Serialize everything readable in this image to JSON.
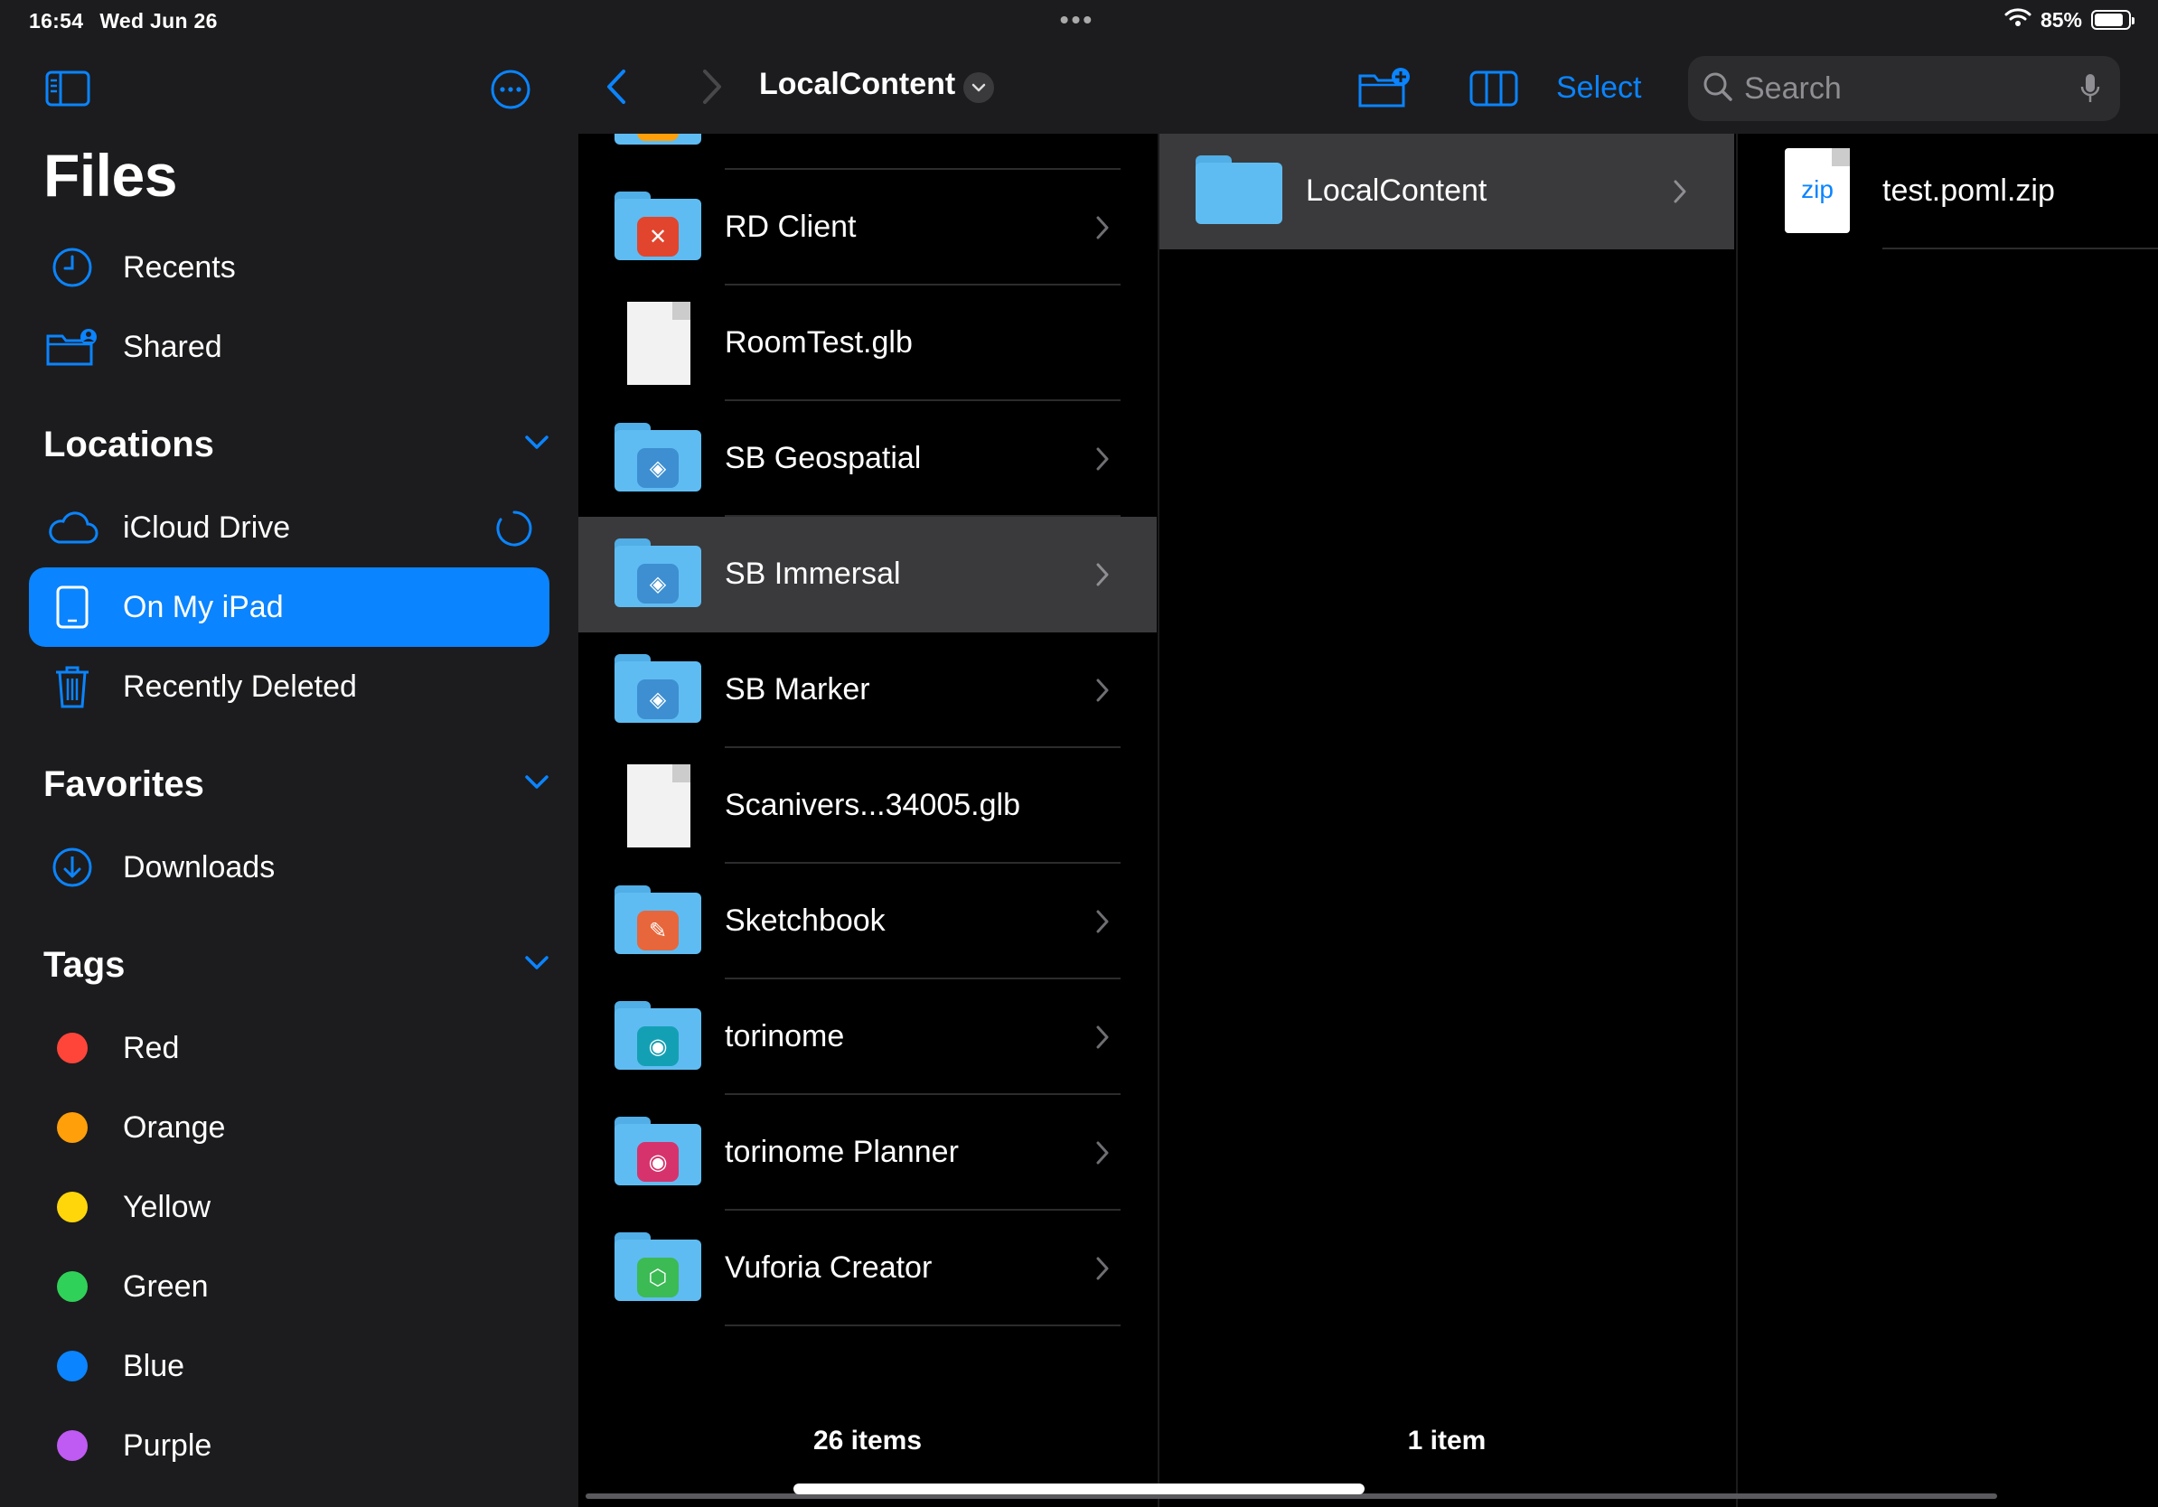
{
  "status_bar": {
    "time": "16:54",
    "date": "Wed Jun 26",
    "battery": "85%"
  },
  "sidebar": {
    "title": "Files",
    "top_items": [
      {
        "label": "Recents",
        "icon": "clock-icon"
      },
      {
        "label": "Shared",
        "icon": "shared-folder-icon"
      }
    ],
    "locations": {
      "heading": "Locations",
      "items": [
        {
          "label": "iCloud Drive",
          "icon": "cloud-icon"
        },
        {
          "label": "On My iPad",
          "icon": "ipad-icon",
          "selected": true
        },
        {
          "label": "Recently Deleted",
          "icon": "trash-icon"
        }
      ]
    },
    "favorites": {
      "heading": "Favorites",
      "items": [
        {
          "label": "Downloads",
          "icon": "download-icon"
        }
      ]
    },
    "tags": {
      "heading": "Tags",
      "items": [
        {
          "label": "Red",
          "color": "#ff453a"
        },
        {
          "label": "Orange",
          "color": "#ff9f0a"
        },
        {
          "label": "Yellow",
          "color": "#ffd60a"
        },
        {
          "label": "Green",
          "color": "#30d158"
        },
        {
          "label": "Blue",
          "color": "#0a84ff"
        },
        {
          "label": "Purple",
          "color": "#bf5af2"
        }
      ]
    }
  },
  "toolbar": {
    "title": "LocalContent",
    "select_label": "Select",
    "search_placeholder": "Search"
  },
  "column1": {
    "items": [
      {
        "name": "RD Client",
        "type": "folder",
        "badge_color": "#e2452d",
        "badge_glyph": "✕"
      },
      {
        "name": "RoomTest.glb",
        "type": "file"
      },
      {
        "name": "SB Geospatial",
        "type": "folder",
        "badge_color": "#3d8fd1",
        "badge_glyph": "◈"
      },
      {
        "name": "SB Immersal",
        "type": "folder",
        "badge_color": "#3d8fd1",
        "badge_glyph": "◈",
        "selected": true
      },
      {
        "name": "SB Marker",
        "type": "folder",
        "badge_color": "#3d8fd1",
        "badge_glyph": "◈"
      },
      {
        "name": "Scanivers...34005.glb",
        "type": "file"
      },
      {
        "name": "Sketchbook",
        "type": "folder",
        "badge_color": "#e8663b",
        "badge_glyph": "✎"
      },
      {
        "name": "torinome",
        "type": "folder",
        "badge_color": "#14a0b4",
        "badge_glyph": "◉"
      },
      {
        "name": "torinome Planner",
        "type": "folder",
        "badge_color": "#d6336c",
        "badge_glyph": "◉"
      },
      {
        "name": "Vuforia Creator",
        "type": "folder",
        "badge_color": "#3cba54",
        "badge_glyph": "⬡"
      }
    ],
    "count": "26 items"
  },
  "column2": {
    "items": [
      {
        "name": "LocalContent",
        "type": "folder",
        "selected": true
      }
    ],
    "count": "1 item"
  },
  "column3": {
    "items": [
      {
        "name": "test.poml.zip",
        "type": "zip",
        "label": "zip"
      }
    ]
  }
}
